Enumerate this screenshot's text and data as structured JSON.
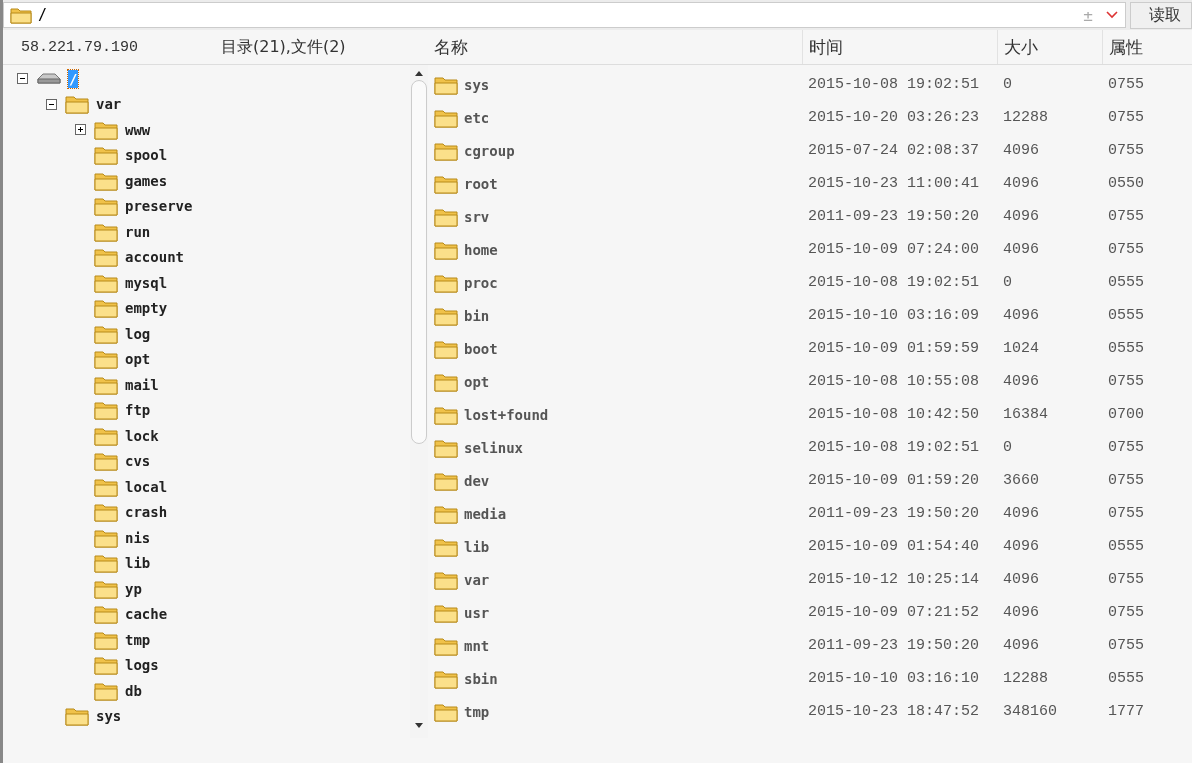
{
  "address_bar": {
    "path": "/",
    "plus_minus": "±",
    "read_button": "读取"
  },
  "sidebar": {
    "host": "58.221.79.190",
    "summary": "目录(21),文件(2)",
    "tree": [
      {
        "name": "/",
        "kind": "drive",
        "expanded": true,
        "selected": true,
        "children": [
          {
            "name": "var",
            "kind": "folder",
            "expanded": true,
            "selected": false,
            "children": [
              {
                "name": "www",
                "kind": "folder",
                "expanded": false,
                "selected": false
              },
              {
                "name": "spool",
                "kind": "folder",
                "selected": false
              },
              {
                "name": "games",
                "kind": "folder",
                "selected": false
              },
              {
                "name": "preserve",
                "kind": "folder",
                "selected": false
              },
              {
                "name": "run",
                "kind": "folder",
                "selected": false
              },
              {
                "name": "account",
                "kind": "folder",
                "selected": false
              },
              {
                "name": "mysql",
                "kind": "folder",
                "selected": false
              },
              {
                "name": "empty",
                "kind": "folder",
                "selected": false
              },
              {
                "name": "log",
                "kind": "folder",
                "selected": false
              },
              {
                "name": "opt",
                "kind": "folder",
                "selected": false
              },
              {
                "name": "mail",
                "kind": "folder",
                "selected": false
              },
              {
                "name": "ftp",
                "kind": "folder",
                "selected": false
              },
              {
                "name": "lock",
                "kind": "folder",
                "selected": false
              },
              {
                "name": "cvs",
                "kind": "folder",
                "selected": false
              },
              {
                "name": "local",
                "kind": "folder",
                "selected": false
              },
              {
                "name": "crash",
                "kind": "folder",
                "selected": false
              },
              {
                "name": "nis",
                "kind": "folder",
                "selected": false
              },
              {
                "name": "lib",
                "kind": "folder",
                "selected": false
              },
              {
                "name": "yp",
                "kind": "folder",
                "selected": false
              },
              {
                "name": "cache",
                "kind": "folder",
                "selected": false
              },
              {
                "name": "tmp",
                "kind": "folder",
                "selected": false
              },
              {
                "name": "logs",
                "kind": "folder",
                "selected": false
              },
              {
                "name": "db",
                "kind": "folder",
                "selected": false
              }
            ]
          },
          {
            "name": "sys",
            "kind": "folder",
            "selected": false
          }
        ]
      }
    ]
  },
  "table": {
    "columns": [
      "名称",
      "时间",
      "大小",
      "属性"
    ],
    "rows": [
      [
        "sys",
        "2015-10-08 19:02:51",
        "0",
        "0755"
      ],
      [
        "etc",
        "2015-10-20 03:26:23",
        "12288",
        "0755"
      ],
      [
        "cgroup",
        "2015-07-24 02:08:37",
        "4096",
        "0755"
      ],
      [
        "root",
        "2015-10-23 11:00:41",
        "4096",
        "0550"
      ],
      [
        "srv",
        "2011-09-23 19:50:20",
        "4096",
        "0755"
      ],
      [
        "home",
        "2015-10-09 07:24:00",
        "4096",
        "0755"
      ],
      [
        "proc",
        "2015-10-08 19:02:51",
        "0",
        "0555"
      ],
      [
        "bin",
        "2015-10-10 03:16:09",
        "4096",
        "0555"
      ],
      [
        "boot",
        "2015-10-09 01:59:59",
        "1024",
        "0555"
      ],
      [
        "opt",
        "2015-10-08 10:55:08",
        "4096",
        "0755"
      ],
      [
        "lost+found",
        "2015-10-08 10:42:50",
        "16384",
        "0700"
      ],
      [
        "selinux",
        "2015-10-08 19:02:51",
        "0",
        "0755"
      ],
      [
        "dev",
        "2015-10-09 01:59:20",
        "3660",
        "0755"
      ],
      [
        "media",
        "2011-09-23 19:50:20",
        "4096",
        "0755"
      ],
      [
        "lib",
        "2015-10-09 01:54:40",
        "4096",
        "0555"
      ],
      [
        "var",
        "2015-10-12 10:25:14",
        "4096",
        "0755"
      ],
      [
        "usr",
        "2015-10-09 07:21:52",
        "4096",
        "0755"
      ],
      [
        "mnt",
        "2011-09-23 19:50:20",
        "4096",
        "0755"
      ],
      [
        "sbin",
        "2015-10-10 03:16:10",
        "12288",
        "0555"
      ],
      [
        "tmp",
        "2015-10-23 18:47:52",
        "348160",
        "1777"
      ]
    ]
  }
}
